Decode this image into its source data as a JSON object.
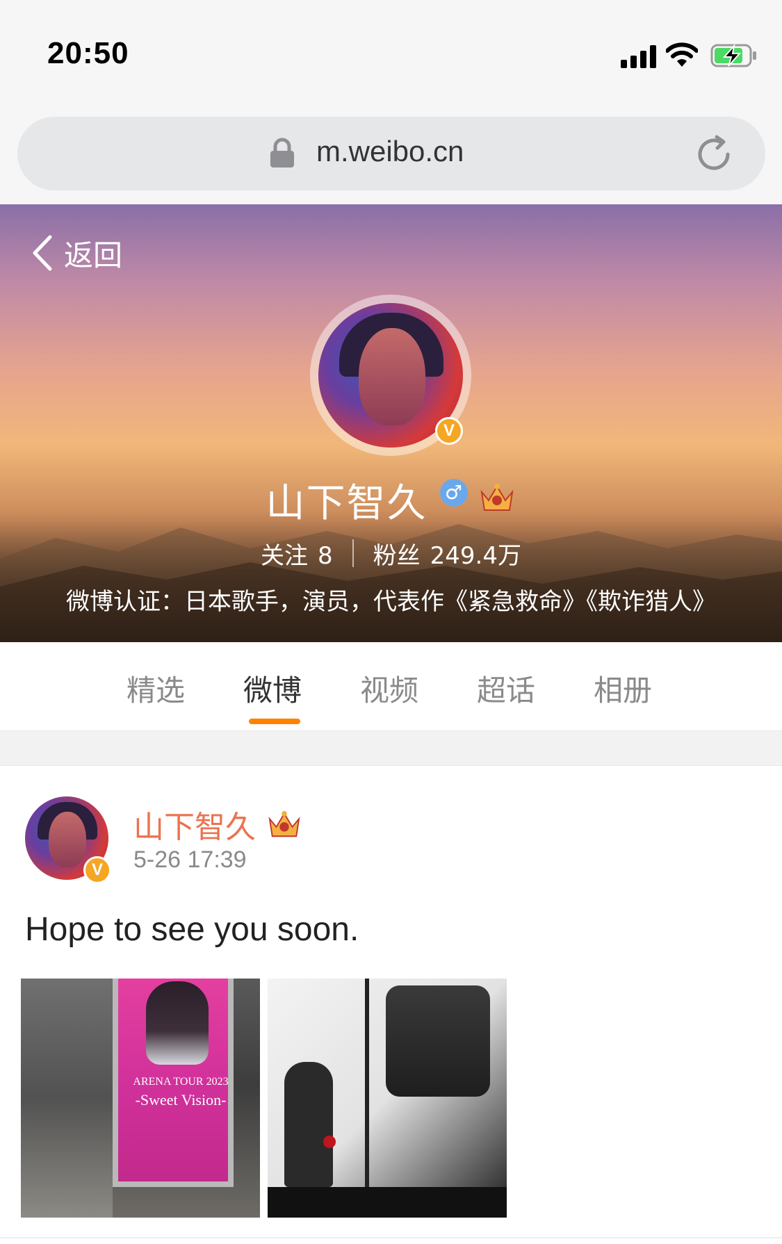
{
  "status_bar": {
    "time": "20:50"
  },
  "browser": {
    "url": "m.weibo.cn"
  },
  "header": {
    "back_label": "返回",
    "name": "山下智久",
    "gender_symbol": "♂",
    "verified_mark": "V",
    "following_label": "关注",
    "following_count": "8",
    "followers_label": "粉丝",
    "followers_count": "249.4万",
    "verification": "微博认证：日本歌手，演员，代表作《紧急救命》《欺诈猎人》"
  },
  "tabs": [
    {
      "label": "精选",
      "active": false
    },
    {
      "label": "微博",
      "active": true
    },
    {
      "label": "视频",
      "active": false
    },
    {
      "label": "超话",
      "active": false
    },
    {
      "label": "相册",
      "active": false
    }
  ],
  "post": {
    "author": "山下智久",
    "verified_mark": "V",
    "time": "5-26 17:39",
    "text": "Hope to see you soon.",
    "image1": {
      "line1": "ARENA TOUR 2023",
      "line2": "-Sweet Vision-"
    }
  },
  "colors": {
    "accent": "#ff8200",
    "author_name": "#eb7350",
    "verified": "#f5a623",
    "gender": "#6aa8ec"
  }
}
